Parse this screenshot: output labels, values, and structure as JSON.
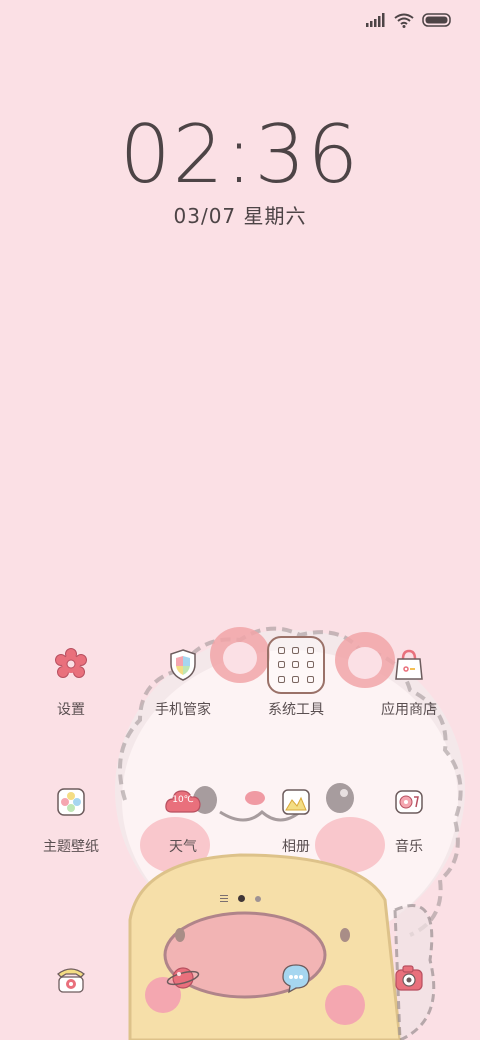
{
  "status": {
    "signal_icon": "signal-bars-icon",
    "wifi_icon": "wifi-icon",
    "battery_icon": "battery-icon",
    "battery_level": 1.0
  },
  "lockscreen": {
    "time": "02:36",
    "date": "03/07 星期六"
  },
  "apps_row1": [
    {
      "label": "设置",
      "icon": "settings-flower-icon"
    },
    {
      "label": "手机管家",
      "icon": "shield-icon"
    },
    {
      "label": "系统工具",
      "icon": "tools-folder-icon"
    },
    {
      "label": "应用商店",
      "icon": "shopping-bag-icon"
    }
  ],
  "apps_row2": [
    {
      "label": "主题壁纸",
      "icon": "theme-palette-icon"
    },
    {
      "label": "天气",
      "icon": "weather-cloud-icon",
      "temp": "10℃"
    },
    {
      "label": "相册",
      "icon": "gallery-icon"
    },
    {
      "label": "音乐",
      "icon": "music-icon"
    }
  ],
  "dock": [
    {
      "icon": "phone-icon"
    },
    {
      "icon": "browser-planet-icon"
    },
    {
      "icon": "messages-icon"
    },
    {
      "icon": "camera-icon"
    }
  ],
  "pager": {
    "pages": 3,
    "active": 1
  },
  "colors": {
    "background": "#fbe0e5",
    "accent_pink": "#e9707c",
    "text": "#4d4446"
  }
}
